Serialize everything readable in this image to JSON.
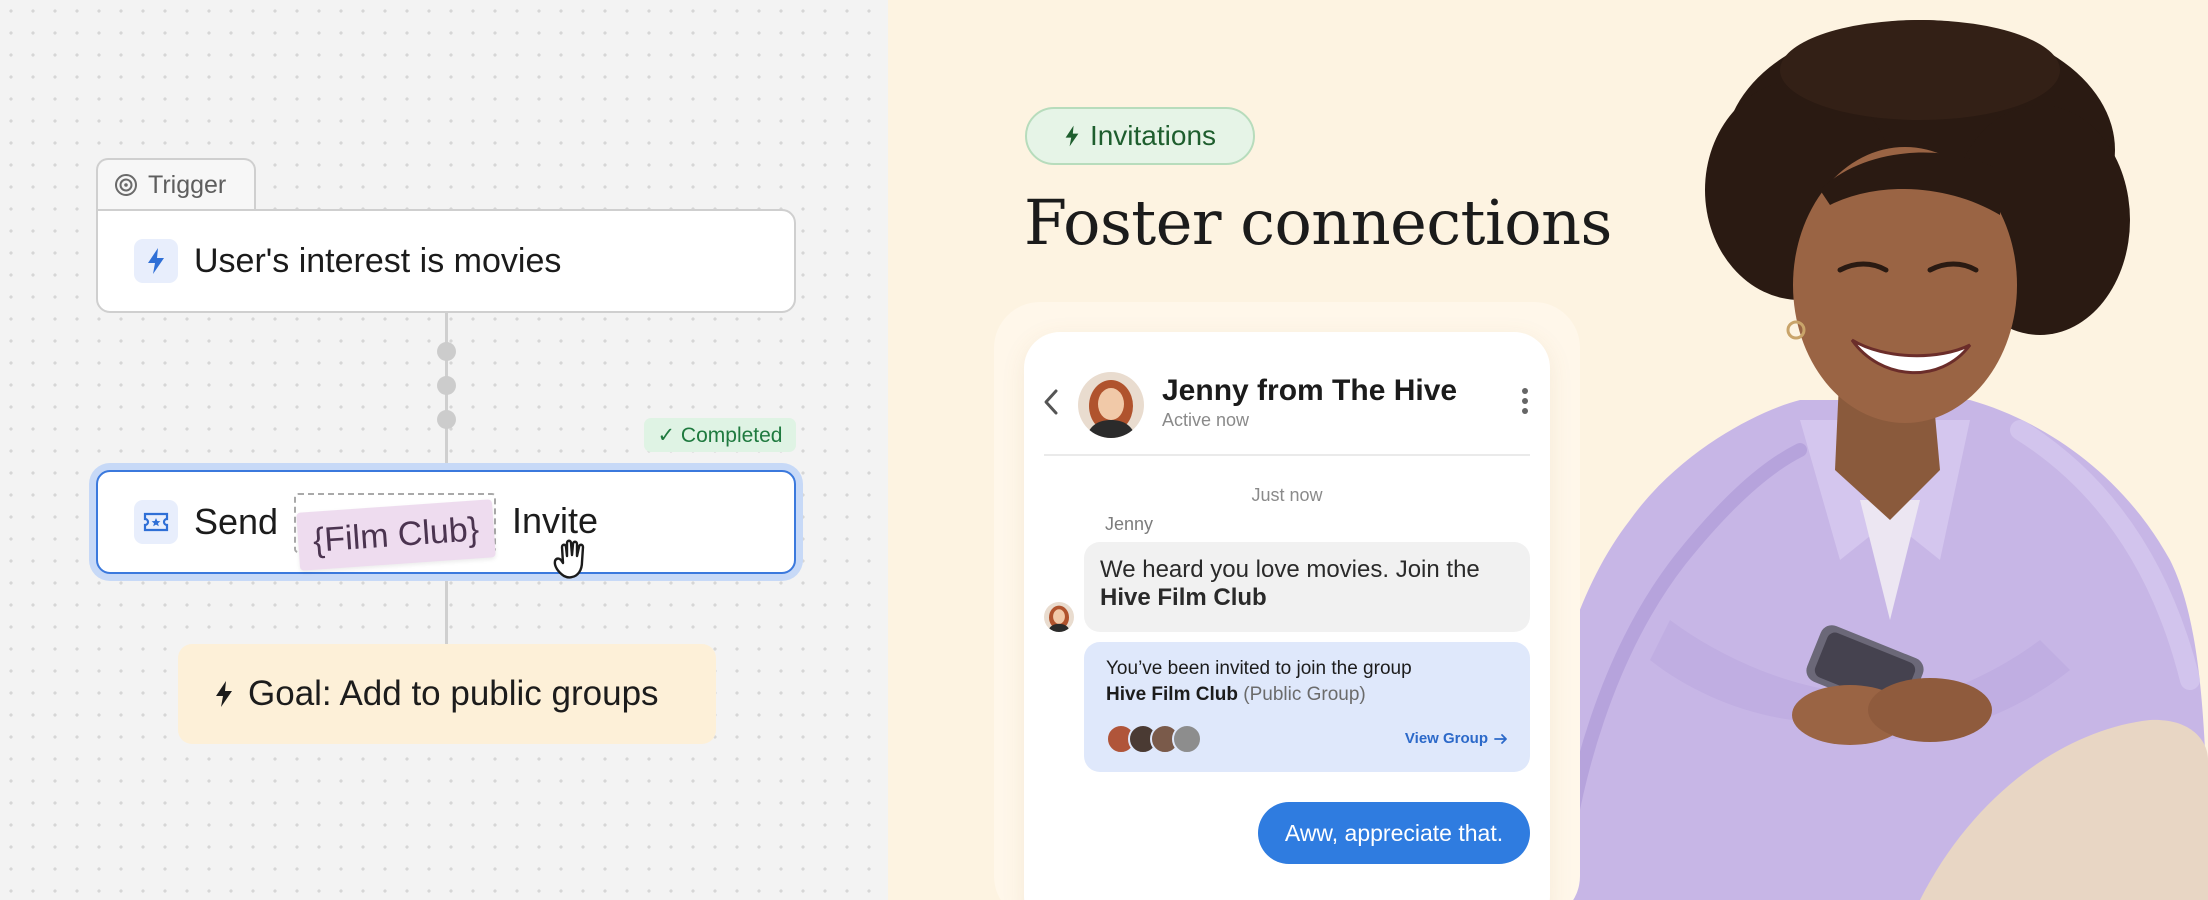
{
  "workflow": {
    "trigger_tab_label": "Trigger",
    "trigger_text": "User's interest is movies",
    "status_badge": "✓ Completed",
    "action": {
      "verb": "Send",
      "variable": "{Film Club}",
      "noun": "Invite"
    },
    "goal_text": "Goal: Add to public groups"
  },
  "hero": {
    "pill_label": "Invitations",
    "headline": "Foster connections"
  },
  "chat": {
    "contact_name": "Jenny from The Hive",
    "contact_status": "Active now",
    "timestamp": "Just now",
    "sender_name": "Jenny",
    "message_text": "We heard you love movies. Join the",
    "message_bold": "Hive Film Club",
    "invite_line": "You’ve been invited to join the group",
    "group_name": "Hive Film Club",
    "group_type": "(Public Group)",
    "view_group_label": "View Group",
    "reply_text": "Aww, appreciate that."
  },
  "colors": {
    "accent_blue": "#2f7ce0",
    "completed_green": "#1f7a3f",
    "goal_bg": "#fdf0d8",
    "hero_bg": "#fdf3e1",
    "variable_tag_bg": "#eedcef"
  },
  "icons": [
    "target-icon",
    "lightning-icon",
    "ticket-icon",
    "hand-cursor-icon",
    "chevron-left-icon",
    "kebab-menu-icon",
    "arrow-right-icon"
  ]
}
